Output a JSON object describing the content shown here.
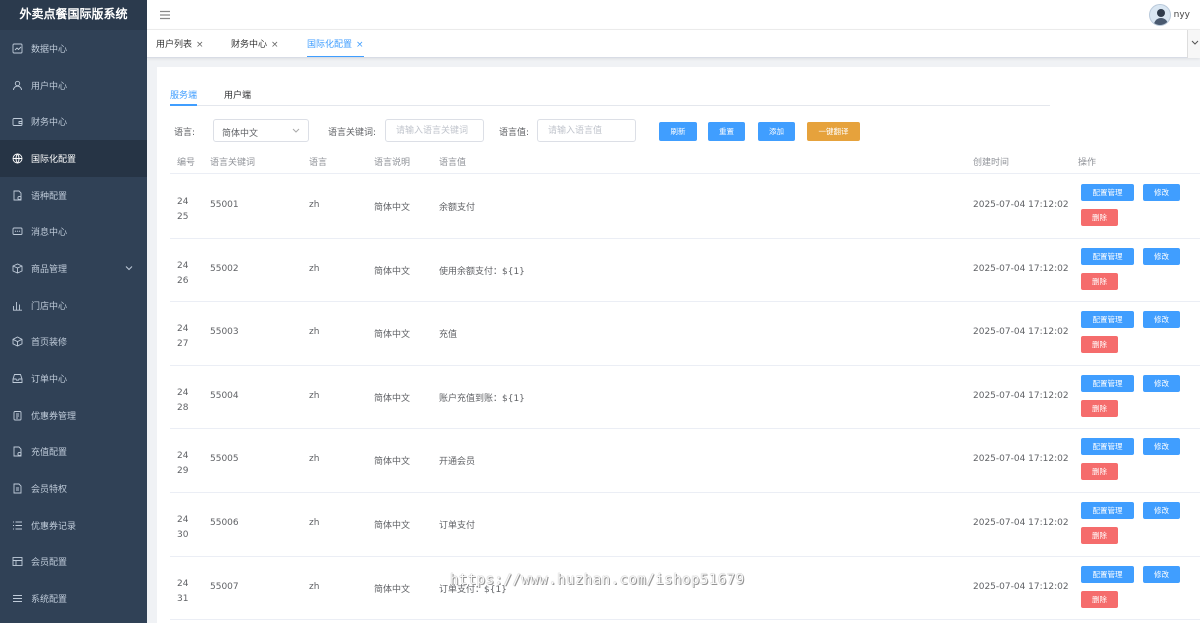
{
  "app": {
    "title": "外卖点餐国际版系统"
  },
  "sidebar": {
    "items": [
      {
        "label": "数据中心",
        "icon": "chart-icon"
      },
      {
        "label": "用户中心",
        "icon": "user-icon"
      },
      {
        "label": "财务中心",
        "icon": "wallet-icon"
      },
      {
        "label": "国际化配置",
        "icon": "globe-icon",
        "active": true
      },
      {
        "label": "语种配置",
        "icon": "doc-gear-icon"
      },
      {
        "label": "消息中心",
        "icon": "message-icon"
      },
      {
        "label": "商品管理",
        "icon": "box-icon",
        "expandable": true
      },
      {
        "label": "门店中心",
        "icon": "bar-chart-icon"
      },
      {
        "label": "首页装修",
        "icon": "cube-icon"
      },
      {
        "label": "订单中心",
        "icon": "tray-icon"
      },
      {
        "label": "优惠券管理",
        "icon": "clipboard-icon"
      },
      {
        "label": "充值配置",
        "icon": "doc-gear-icon"
      },
      {
        "label": "会员特权",
        "icon": "doc-icon"
      },
      {
        "label": "优惠券记录",
        "icon": "list-icon"
      },
      {
        "label": "会员配置",
        "icon": "table-icon"
      },
      {
        "label": "系统配置",
        "icon": "menu-icon"
      }
    ]
  },
  "header": {
    "username": "nyy"
  },
  "tabs": [
    {
      "label": "用户列表",
      "close": "×"
    },
    {
      "label": "财务中心",
      "close": "×"
    },
    {
      "label": "国际化配置",
      "close": "×",
      "active": true
    }
  ],
  "subtabs": [
    {
      "label": "服务端",
      "active": true
    },
    {
      "label": "用户端"
    }
  ],
  "filters": {
    "language_label": "语言:",
    "language_value": "简体中文",
    "keyword_label": "语言关键词:",
    "keyword_placeholder": "请输入语言关键词",
    "value_label": "语言值:",
    "value_placeholder": "请输入语言值",
    "refresh": "刷新",
    "reset": "重置",
    "add": "添加",
    "translate": "一键翻译"
  },
  "table": {
    "columns": [
      "编号",
      "语言关键词",
      "语言",
      "语言说明",
      "语言值",
      "创建时间",
      "操作"
    ],
    "row_actions": {
      "config": "配置管理",
      "edit": "修改",
      "delete": "删除"
    },
    "rows": [
      {
        "id": "2425",
        "key": "55001",
        "lang": "zh",
        "desc": "简体中文",
        "value": "余额支付",
        "created": "2025-07-04 17:12:02"
      },
      {
        "id": "2426",
        "key": "55002",
        "lang": "zh",
        "desc": "简体中文",
        "value": "使用余额支付：${1}",
        "created": "2025-07-04 17:12:02"
      },
      {
        "id": "2427",
        "key": "55003",
        "lang": "zh",
        "desc": "简体中文",
        "value": "充值",
        "created": "2025-07-04 17:12:02"
      },
      {
        "id": "2428",
        "key": "55004",
        "lang": "zh",
        "desc": "简体中文",
        "value": "账户充值到账：${1}",
        "created": "2025-07-04 17:12:02"
      },
      {
        "id": "2429",
        "key": "55005",
        "lang": "zh",
        "desc": "简体中文",
        "value": "开通会员",
        "created": "2025-07-04 17:12:02"
      },
      {
        "id": "2430",
        "key": "55006",
        "lang": "zh",
        "desc": "简体中文",
        "value": "订单支付",
        "created": "2025-07-04 17:12:02"
      },
      {
        "id": "2431",
        "key": "55007",
        "lang": "zh",
        "desc": "简体中文",
        "value": "订单支付：${1}",
        "created": "2025-07-04 17:12:02"
      }
    ]
  },
  "watermark": "https://www.huzhan.com/ishop51679",
  "colors": {
    "sidebar_bg": "#304156",
    "primary": "#409eff",
    "warning": "#e6a23c",
    "danger": "#f56c6c"
  }
}
